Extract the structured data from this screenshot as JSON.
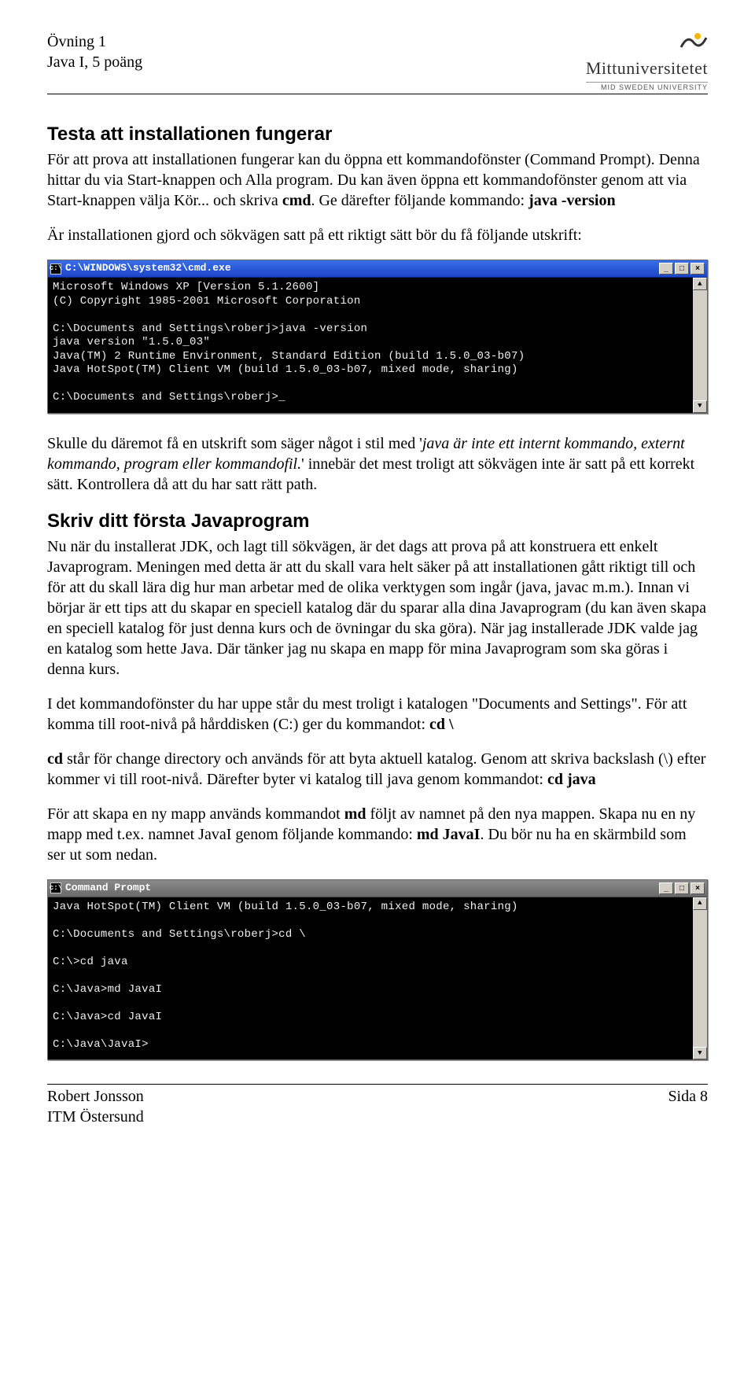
{
  "header": {
    "line1": "Övning 1",
    "line2": "Java I, 5 poäng",
    "logo_name": "Mittuniversitetet",
    "logo_sub": "MID SWEDEN UNIVERSITY"
  },
  "section1": {
    "heading": "Testa att installationen fungerar",
    "p1a": "För att prova att installationen fungerar kan du öppna ett kommandofönster (Command Prompt). Denna hittar du via Start-knappen och Alla program. Du kan även öppna ett kommandofönster genom att via Start-knappen välja Kör... och skriva ",
    "p1b": "cmd",
    "p1c": ". Ge därefter följande kommando: ",
    "p1d": "java -version",
    "p2": "Är installationen gjord och sökvägen satt på ett riktigt sätt bör du få följande utskrift:"
  },
  "cmd1": {
    "title": "C:\\WINDOWS\\system32\\cmd.exe",
    "lines": "Microsoft Windows XP [Version 5.1.2600]\n(C) Copyright 1985-2001 Microsoft Corporation\n\nC:\\Documents and Settings\\roberj>java -version\njava version \"1.5.0_03\"\nJava(TM) 2 Runtime Environment, Standard Edition (build 1.5.0_03-b07)\nJava HotSpot(TM) Client VM (build 1.5.0_03-b07, mixed mode, sharing)\n\nC:\\Documents and Settings\\roberj>_"
  },
  "section2": {
    "p3a": "Skulle du däremot få en utskrift som säger något i stil med '",
    "p3b": "java är inte ett internt kommando, externt kommando, program eller kommandofil.",
    "p3c": "' innebär det mest troligt att sökvägen inte är satt på ett korrekt sätt. Kontrollera då att du har satt rätt path.",
    "heading": "Skriv ditt första Javaprogram",
    "p4": "Nu när du installerat JDK, och lagt till sökvägen, är det dags att prova på att konstruera ett enkelt Javaprogram. Meningen med detta är att du skall vara helt säker på att installationen gått riktigt till och för att du skall lära dig hur man arbetar med de olika verktygen som ingår (java, javac m.m.). Innan vi börjar är ett tips att du skapar en speciell katalog där du sparar alla dina Javaprogram (du kan även skapa en speciell katalog för just denna kurs och de övningar du ska göra). När jag installerade JDK valde jag en katalog som hette Java. Där tänker jag nu skapa en mapp för mina Javaprogram som ska göras i denna kurs.",
    "p5a": "I det kommandofönster du har uppe står du mest troligt i katalogen \"Documents and Settings\". För att komma till root-nivå på hårddisken (C:) ger du kommandot: ",
    "p5b": "cd \\",
    "p6a": "cd",
    "p6b": " står för change directory och används för att byta aktuell katalog. Genom att skriva backslash (\\) efter kommer vi till root-nivå. Därefter byter vi katalog till java genom kommandot: ",
    "p6c": "cd java",
    "p7a": "För att skapa en ny mapp används kommandot ",
    "p7b": "md",
    "p7c": " följt av namnet på den nya mappen. Skapa nu en ny mapp med t.ex. namnet JavaI genom följande kommando: ",
    "p7d": "md JavaI",
    "p7e": ". Du bör nu ha en skärmbild som ser ut som nedan."
  },
  "cmd2": {
    "title": "Command Prompt",
    "lines": "Java HotSpot(TM) Client VM (build 1.5.0_03-b07, mixed mode, sharing)\n\nC:\\Documents and Settings\\roberj>cd \\\n\nC:\\>cd java\n\nC:\\Java>md JavaI\n\nC:\\Java>cd JavaI\n\nC:\\Java\\JavaI>"
  },
  "footer": {
    "left1": "Robert Jonsson",
    "left2": "ITM Östersund",
    "right": "Sida 8"
  }
}
